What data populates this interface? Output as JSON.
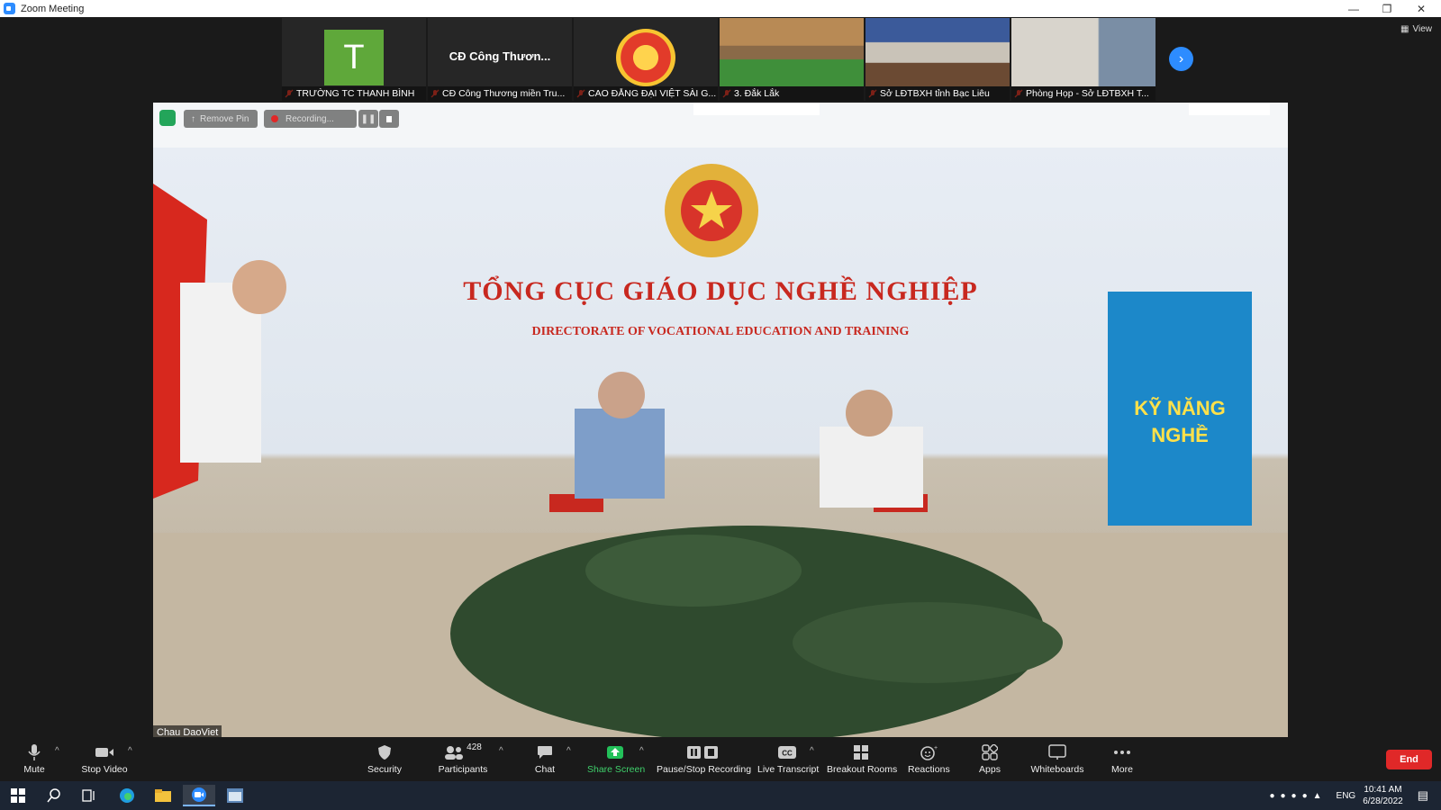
{
  "window": {
    "title": "Zoom Meeting"
  },
  "top_bar": {
    "view_label": "View"
  },
  "participants_strip": [
    {
      "name": "TRƯỜNG TC THANH BÌNH",
      "avatar_letter": "T",
      "kind": "avatar"
    },
    {
      "name": "CĐ Công Thương miền Tru...",
      "display_name": "CĐ Công Thươn...",
      "kind": "text"
    },
    {
      "name": "CAO ĐẲNG ĐẠI VIỆT SÀI G...",
      "kind": "logo"
    },
    {
      "name": "3. Đắk Lắk",
      "kind": "video"
    },
    {
      "name": "Sở LĐTBXH tỉnh Bạc Liêu",
      "kind": "video"
    },
    {
      "name": "Phòng Họp - Sở LĐTBXH T...",
      "kind": "video"
    }
  ],
  "main_video": {
    "remove_pin_label": "Remove Pin",
    "recording_label": "Recording...",
    "speaker_name": "Chau DaoViet",
    "banner_title": "TỔNG CỤC GIÁO DỤC NGHỀ NGHIỆP",
    "banner_subtitle": "DIRECTORATE OF VOCATIONAL EDUCATION AND TRAINING",
    "standee_text": "KỸ NĂNG NGHỀ"
  },
  "toolbar": {
    "mute": "Mute",
    "stop_video": "Stop Video",
    "security": "Security",
    "participants": "Participants",
    "participants_count": "428",
    "chat": "Chat",
    "share_screen": "Share Screen",
    "pause_stop_recording": "Pause/Stop Recording",
    "live_transcript": "Live Transcript",
    "breakout_rooms": "Breakout Rooms",
    "reactions": "Reactions",
    "apps": "Apps",
    "whiteboards": "Whiteboards",
    "more": "More",
    "end": "End"
  },
  "taskbar": {
    "language": "ENG",
    "time": "10:41 AM",
    "date": "6/28/2022"
  },
  "colors": {
    "accent": "#2d8cff",
    "end": "#e02828",
    "share": "#23c15a"
  }
}
